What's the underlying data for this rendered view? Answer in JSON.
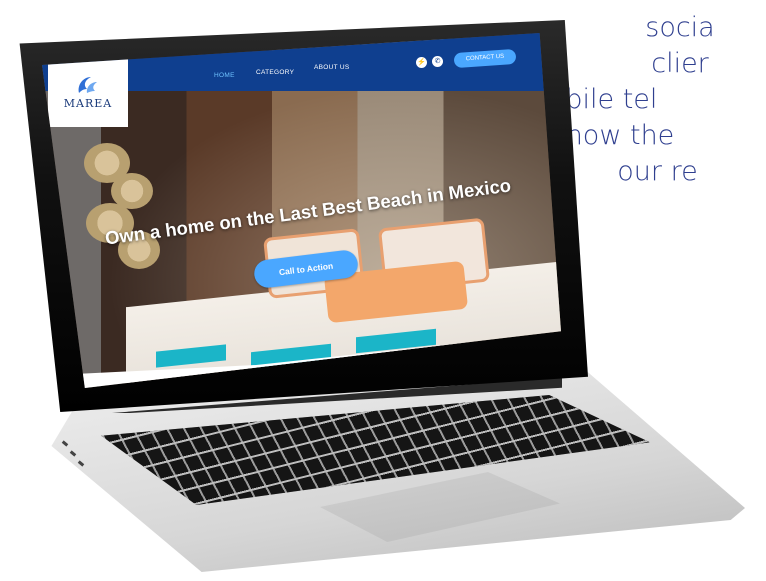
{
  "side_copy": {
    "lines": [
      "socia",
      "clier",
      "mobile tel",
      "now the",
      "our re"
    ],
    "color": "#2f3f8f"
  },
  "site": {
    "logo_text": "MAREA",
    "nav": {
      "links": [
        {
          "label": "HOME",
          "active": true
        },
        {
          "label": "CATEGORY",
          "active": false
        },
        {
          "label": "ABOUT US",
          "active": false
        }
      ],
      "icons": [
        "messenger-icon",
        "whatsapp-icon"
      ],
      "contact_label": "CONTACT US"
    },
    "hero": {
      "title": "Own a home on the Last Best Beach in Mexico",
      "cta_label": "Call to Action"
    },
    "colors": {
      "navbar": "#0f3f8f",
      "accent": "#4aa7ff",
      "stripe": "#1bb5c8"
    }
  }
}
